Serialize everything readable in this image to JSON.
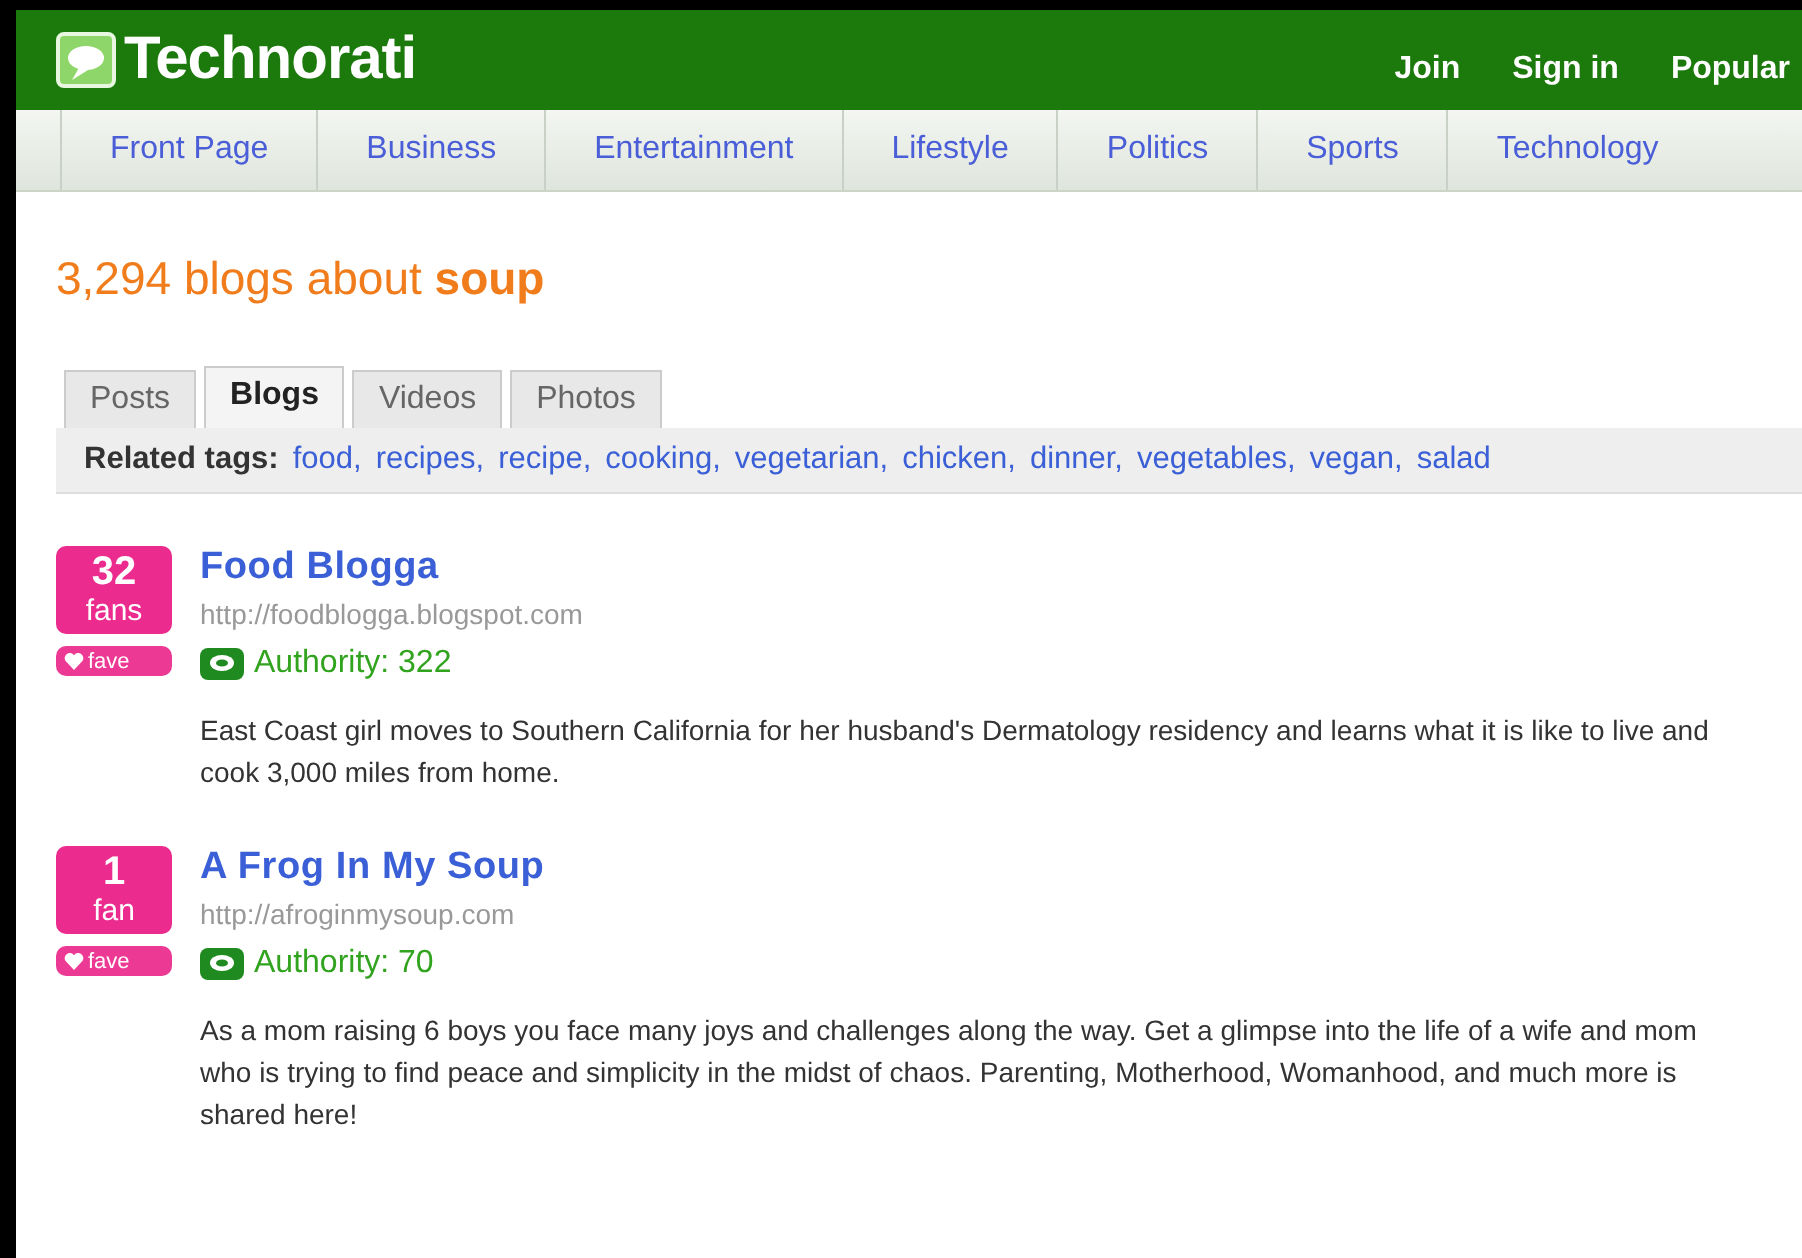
{
  "header": {
    "logo": "Technorati",
    "links": [
      "Join",
      "Sign in",
      "Popular"
    ]
  },
  "nav": [
    "Front Page",
    "Business",
    "Entertainment",
    "Lifestyle",
    "Politics",
    "Sports",
    "Technology"
  ],
  "heading": "3,294 blogs about **soup**",
  "tabs": [
    {
      "label": "Posts",
      "selected": false
    },
    {
      "label": "Blogs",
      "selected": true
    },
    {
      "label": "Videos",
      "selected": false
    },
    {
      "label": "Photos",
      "selected": false
    }
  ],
  "related_tags": {
    "label": "Related tags:",
    "tags": [
      "food,",
      "recipes,",
      "recipe,",
      "cooking,",
      "vegetarian,",
      "chicken,",
      "dinner,",
      "vegetables,",
      "vegan,",
      "salad"
    ]
  },
  "results": [
    {
      "fans_count": "32",
      "fans_label": "fans",
      "fave": "fave",
      "title": "Food Blogga",
      "url": "http://foodblogga.blogspot.com",
      "authority": "Authority: 322",
      "description": "East Coast girl moves to Southern California for her husband's Dermatology residency and learns what it is like to live and cook 3,000 miles from home."
    },
    {
      "fans_count": "1",
      "fans_label": "fan",
      "fave": "fave",
      "title": "A Frog In My Soup",
      "url": "http://afroginmysoup.com",
      "authority": "Authority: 70",
      "description": "As a mom raising 6 boys you face many joys and challenges along the way. Get a glimpse into the life of a wife and mom who is trying to find peace and simplicity in the midst of chaos. Parenting, Motherhood, Womanhood, and much more is shared here!"
    }
  ]
}
